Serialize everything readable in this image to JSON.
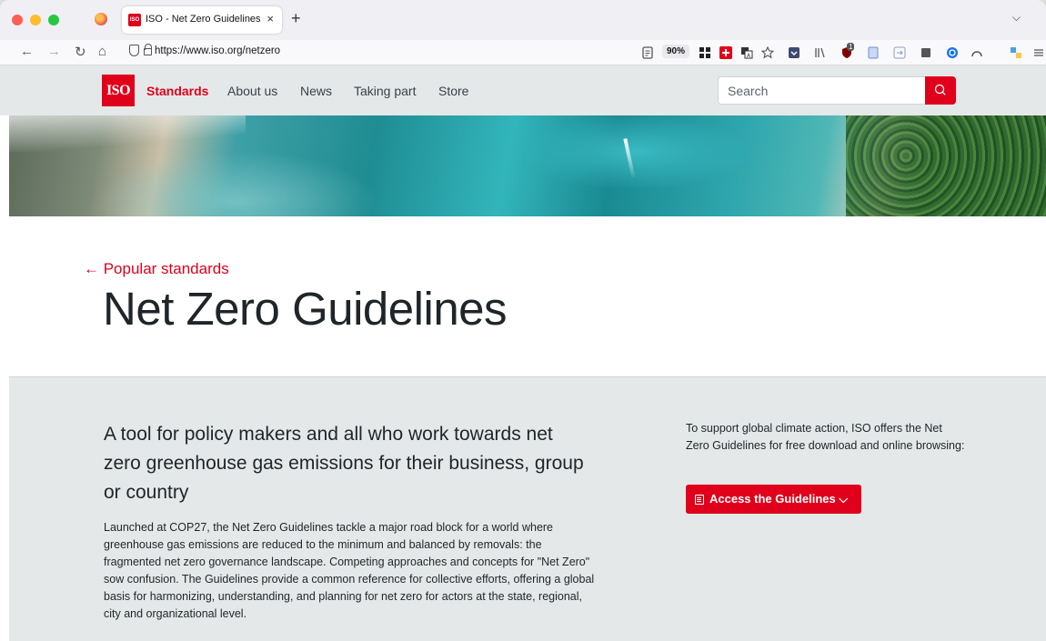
{
  "browser": {
    "tab_title": "ISO - Net Zero Guidelines",
    "tab_close": "×",
    "new_tab": "+",
    "tab_list": "⌵",
    "url": "https://www.iso.org/netzero",
    "zoom": "90%",
    "nav": {
      "back": "←",
      "forward": "→",
      "reload": "↻",
      "home": "⌂"
    },
    "icons": [
      "reader-view-icon",
      "grid-extension-icon",
      "swiss-flag-extension-icon",
      "translate-icon",
      "bookmark-star-icon",
      "pocket-icon",
      "library-icon",
      "ublock-icon",
      "document-icon",
      "share-icon",
      "note-icon",
      "password-manager-icon",
      "extensions-icon",
      "menu-icon"
    ],
    "extension_badge": "1"
  },
  "site": {
    "logo_text": "ISO",
    "menu": [
      {
        "label": "Standards",
        "active": true
      },
      {
        "label": "About us",
        "active": false
      },
      {
        "label": "News",
        "active": false
      },
      {
        "label": "Taking part",
        "active": false
      },
      {
        "label": "Store",
        "active": false
      }
    ],
    "search_placeholder": "Search",
    "accent_color": "#e0001b"
  },
  "page": {
    "back_link": "← Popular standards",
    "title": "Net Zero Guidelines",
    "lead": "A tool for policy makers and all who work towards net zero greenhouse gas emissions for their business, group or country",
    "body": "Launched at COP27, the Net Zero Guidelines tackle a major road block for a world where greenhouse gas emissions are reduced to the minimum and balanced by removals: the fragmented net zero governance landscape. Competing approaches and concepts for \"Net Zero\" sow confusion. The Guidelines provide a common reference for collective efforts, offering a global basis for harmonizing, understanding, and planning for net zero for actors at the state, regional, city and organizational level.",
    "side_text": "To support global climate action, ISO offers the Net Zero Guidelines for free download and online browsing:",
    "cta_label": "Access the Guidelines ⌵"
  }
}
